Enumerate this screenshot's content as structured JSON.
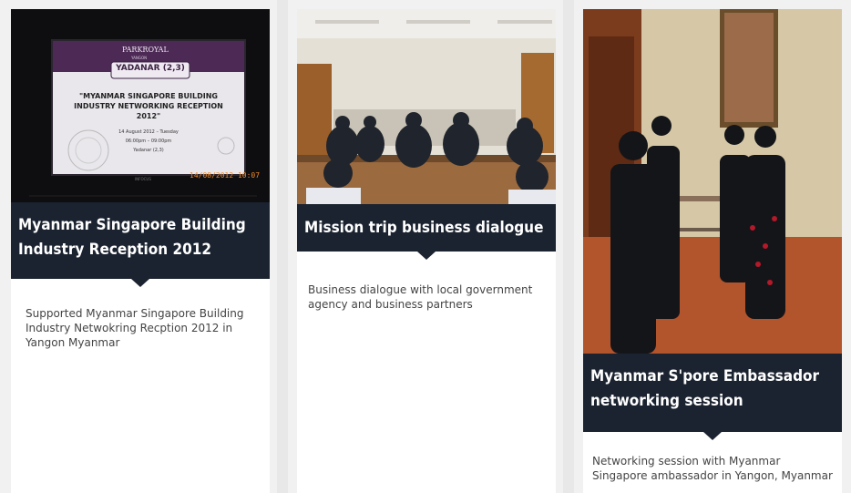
{
  "cards": [
    {
      "title": "Myanmar Singapore Building Industry Reception 2012",
      "description": "Supported Myanmar Singapore Building Industry Netwokring Recption 2012 in Yangon Myanmar",
      "photo": {
        "hotel": "PARKROYAL",
        "hotel_sub": "YANGON",
        "room": "YADANAR (2,3)",
        "event": "\"MYANMAR SINGAPORE BUILDING INDUSTRY NETWORKING RECEPTION 2012\"",
        "date": "14 August 2012 – Tuesday",
        "time": "06:00pm – 09:00pm",
        "venue": "Yadanar (2,3)",
        "stamp": "14/08/2012 10:07",
        "brand": "INFOCUS"
      }
    },
    {
      "title": "Mission trip business dialogue",
      "description": "Business dialogue with local government agency and business partners"
    },
    {
      "title": "Myanmar S'pore Embassador networking session",
      "description": "Networking session with Myanmar Singapore ambassador in Yangon, Myanmar"
    }
  ]
}
